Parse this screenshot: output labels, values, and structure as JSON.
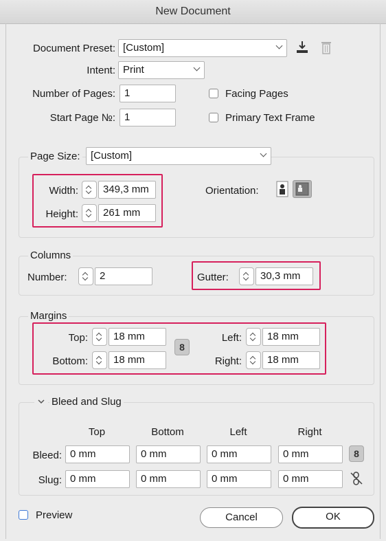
{
  "window": {
    "title": "New Document"
  },
  "preset": {
    "label": "Document Preset:",
    "value": "[Custom]"
  },
  "intent": {
    "label": "Intent:",
    "value": "Print"
  },
  "pages": {
    "label": "Number of Pages:",
    "value": "1",
    "start_label": "Start Page №:",
    "start_value": "1"
  },
  "options": {
    "facing_pages": "Facing Pages",
    "primary_text_frame": "Primary Text Frame"
  },
  "page_size": {
    "label": "Page Size:",
    "value": "[Custom]",
    "width_label": "Width:",
    "width_value": "349,3 mm",
    "height_label": "Height:",
    "height_value": "261 mm",
    "orientation_label": "Orientation:"
  },
  "columns": {
    "title": "Columns",
    "number_label": "Number:",
    "number_value": "2",
    "gutter_label": "Gutter:",
    "gutter_value": "30,3 mm"
  },
  "margins": {
    "title": "Margins",
    "top_label": "Top:",
    "top_value": "18 mm",
    "bottom_label": "Bottom:",
    "bottom_value": "18 mm",
    "left_label": "Left:",
    "left_value": "18 mm",
    "right_label": "Right:",
    "right_value": "18 mm",
    "link_glyph": "8"
  },
  "bleed_slug": {
    "title": "Bleed and Slug",
    "columns": [
      "Top",
      "Bottom",
      "Left",
      "Right"
    ],
    "bleed_label": "Bleed:",
    "bleed_values": [
      "0 mm",
      "0 mm",
      "0 mm",
      "0 mm"
    ],
    "slug_label": "Slug:",
    "slug_values": [
      "0 mm",
      "0 mm",
      "0 mm",
      "0 mm"
    ],
    "link_glyph": "8"
  },
  "footer": {
    "preview_label": "Preview",
    "cancel_label": "Cancel",
    "ok_label": "OK"
  },
  "colors": {
    "highlight": "#d6205c",
    "checkbox_accent": "#3f7ad8"
  }
}
